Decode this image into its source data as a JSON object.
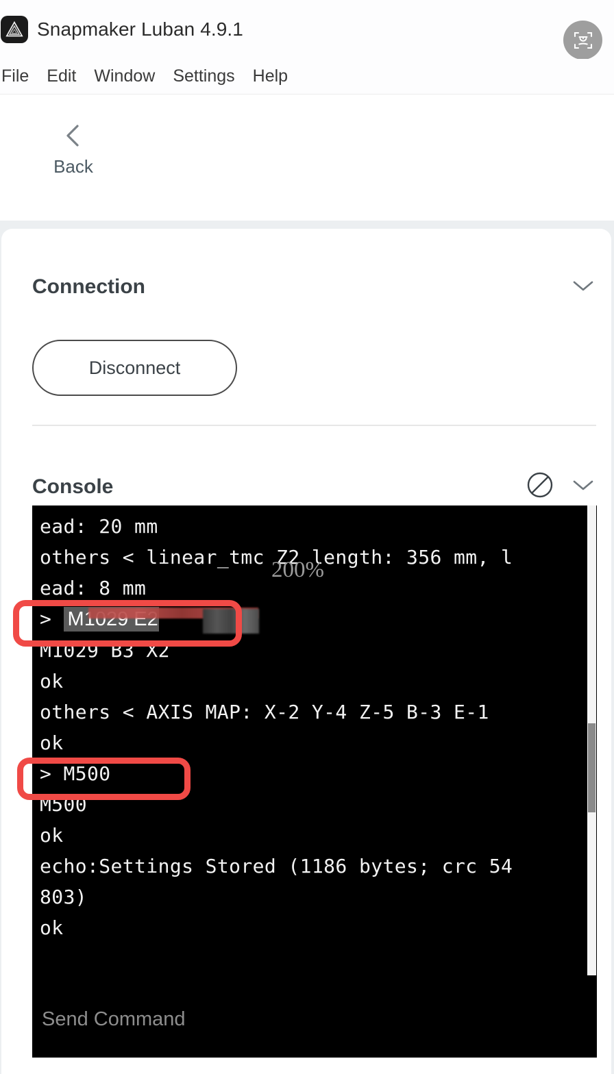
{
  "window": {
    "app_title": "Snapmaker Luban 4.9.1",
    "logo_icon": "snapmaker-triangle-logo-icon",
    "translate_icon": "translate-scan-icon"
  },
  "menubar": {
    "items": [
      {
        "label": "File"
      },
      {
        "label": "Edit"
      },
      {
        "label": "Window"
      },
      {
        "label": "Settings"
      },
      {
        "label": "Help"
      }
    ]
  },
  "navigation": {
    "back_label": "Back",
    "back_icon": "chevron-left-icon"
  },
  "connection": {
    "title": "Connection",
    "collapse_icon": "chevron-down-icon",
    "disconnect_label": "Disconnect"
  },
  "console": {
    "title": "Console",
    "clear_icon": "circle-slash-clear-icon",
    "collapse_icon": "chevron-down-icon",
    "watermark": "200%",
    "input_placeholder": "Send Command",
    "input_value": "",
    "lines": [
      {
        "type": "output",
        "text": "ead: 20 mm"
      },
      {
        "type": "output",
        "text": "others < linear_tmc Z2 length: 356 mm, l"
      },
      {
        "type": "output",
        "text": "ead: 8 mm"
      },
      {
        "type": "command",
        "prompt": ">",
        "text": "M1029 E2",
        "selected": true,
        "redacted": true,
        "annotated": true
      },
      {
        "type": "output",
        "text": "M1029 B3 X2"
      },
      {
        "type": "output",
        "text": "ok"
      },
      {
        "type": "output",
        "text": "others < AXIS MAP: X-2 Y-4 Z-5 B-3 E-1"
      },
      {
        "type": "output",
        "text": "ok"
      },
      {
        "type": "command",
        "prompt": ">",
        "text": "M500",
        "annotated": true
      },
      {
        "type": "output",
        "text": "M500"
      },
      {
        "type": "output",
        "text": "ok"
      },
      {
        "type": "output",
        "text": "echo:Settings Stored (1186 bytes; crc 54"
      },
      {
        "type": "output",
        "text": "803)"
      },
      {
        "type": "output",
        "text": "ok"
      }
    ]
  },
  "colors": {
    "annotation_red": "#f04a46",
    "console_bg": "#000000",
    "console_text": "#f2f2f2",
    "panel_bg": "#eceff1",
    "translate_button_bg": "#9e9e9e"
  }
}
